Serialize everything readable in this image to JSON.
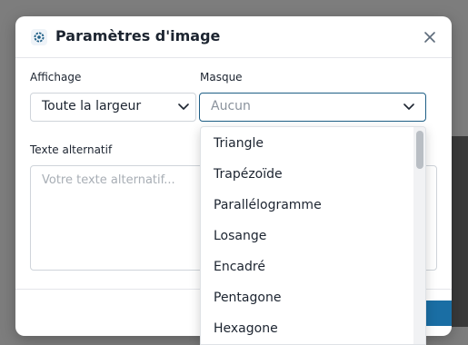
{
  "dialog": {
    "title": "Paramètres d'image",
    "title_icon": "gear-icon",
    "close_icon": "close-icon"
  },
  "display": {
    "label": "Affichage",
    "value": "Toute la largeur",
    "icon": "chevron-down-icon"
  },
  "mask": {
    "label": "Masque",
    "placeholder": "Aucun",
    "icon": "chevron-down-icon",
    "options": [
      "Triangle",
      "Trapézoïde",
      "Parallélogramme",
      "Losange",
      "Encadré",
      "Pentagone",
      "Hexagone"
    ]
  },
  "alt_text": {
    "label": "Texte alternatif",
    "placeholder": "Votre texte alternatif..."
  },
  "colors": {
    "accent": "#1a6ea4",
    "focus_border": "#1f5f86",
    "text": "#1c2430",
    "placeholder": "#a8aeb5"
  }
}
